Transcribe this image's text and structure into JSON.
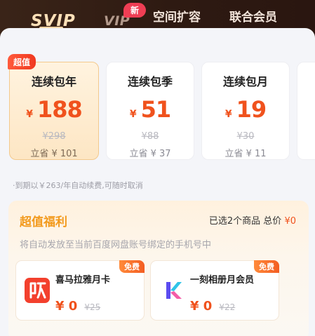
{
  "tabs": {
    "svip": "SVIP",
    "vip": "VIP",
    "vip_badge": "新",
    "space": "空间扩容",
    "union": "联合会员"
  },
  "plans": [
    {
      "title": "连续包年",
      "currency": "¥",
      "price": "188",
      "original": "¥298",
      "save": "立省 ¥ 101",
      "badge": "超值",
      "selected": true
    },
    {
      "title": "连续包季",
      "currency": "¥",
      "price": "51",
      "original": "¥88",
      "save": "立省 ¥ 37"
    },
    {
      "title": "连续包月",
      "currency": "¥",
      "price": "19",
      "original": "¥30",
      "save": "立省 ¥ 11"
    }
  ],
  "auto_renew_note": "·到期以￥263/年自动续费,可随时取消",
  "welfare": {
    "title": "超值福利",
    "summary_prefix": "已选2个商品 总价",
    "summary_total": "¥0",
    "description": "将自动发放至当前百度网盘账号绑定的手机号中",
    "gifts": [
      {
        "name": "喜马拉雅月卡",
        "tag": "免费",
        "price": "¥ 0",
        "original": "¥25",
        "icon": "ximalaya-icon"
      },
      {
        "name": "一刻相册月会员",
        "tag": "免费",
        "price": "¥ 0",
        "original": "¥22",
        "icon": "yike-album-icon"
      }
    ]
  },
  "colors": {
    "accent": "#f0521d",
    "gold": "#f29a1d",
    "header_dark": "#2e1a12"
  }
}
